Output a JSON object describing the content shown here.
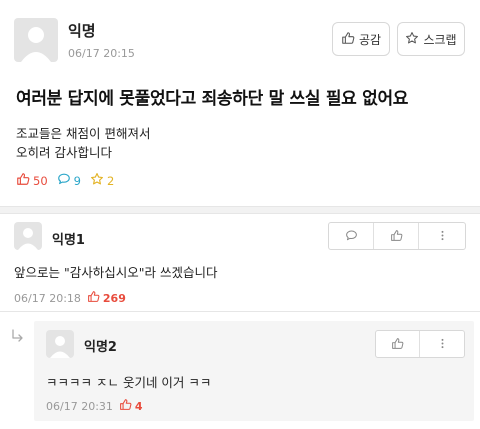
{
  "post": {
    "author": "익명",
    "time": "06/17 20:15",
    "like_button": "공감",
    "scrap_button": "스크랩",
    "title": "여러분 답지에 못풀었다고 죄송하단 말 쓰실 필요 없어요",
    "body_lines": [
      "조교들은 채점이 편해져서",
      "오히려 감사합니다"
    ],
    "stats": {
      "likes": "50",
      "comments": "9",
      "scraps": "2"
    }
  },
  "comments": [
    {
      "author": "익명1",
      "text": "앞으로는 \"감사하십시오\"라 쓰겠습니다",
      "time": "06/17 20:18",
      "likes": "269"
    },
    {
      "author": "익명2",
      "text": "ㅋㅋㅋㅋ ㅈㄴ 웃기네 이거 ㅋㅋ",
      "time": "06/17 20:31",
      "likes": "4"
    }
  ],
  "icons": {
    "thumb": "thumbs-up-icon",
    "star": "star-icon",
    "comment": "speech-bubble-icon",
    "more": "vertical-dots-icon",
    "reply": "reply-arrow-icon"
  },
  "colors": {
    "like": "#e84c3d",
    "comment": "#2aa6c9",
    "scrap": "#e3b325",
    "meta": "#999999"
  }
}
